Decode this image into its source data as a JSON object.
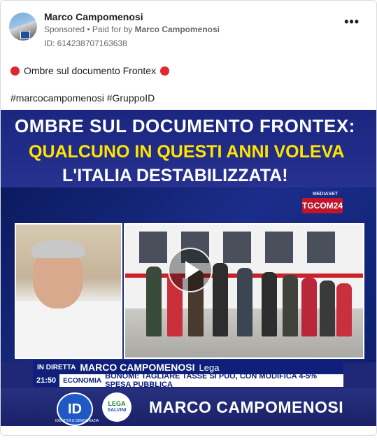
{
  "advertiser": {
    "name": "Marco Campomenosi",
    "sponsored_label": "Sponsored",
    "paid_for_prefix": "Paid for by",
    "paid_for_name": "Marco Campomenosi",
    "ad_id": "ID: 614238707163638"
  },
  "menu": {
    "more_icon": "more-options-icon",
    "more_glyph": "•••"
  },
  "post": {
    "title": "Ombre sul documento Frontex",
    "hashtags": "#marcocampomenosi #GruppoID"
  },
  "video": {
    "headline_line1": "OMBRE SUL DOCUMENTO FRONTEX:",
    "headline_line2": "QUALCUNO IN QUESTI ANNI VOLEVA",
    "headline_line3": "L'ITALIA DESTABILIZZATA!",
    "network_small": "MEDIASET",
    "network_logo": "TGCOM24",
    "ticker_live": "IN DIRETTA",
    "ticker_name": "MARCO CAMPOMENOSI",
    "ticker_party": "Lega",
    "ticker_time": "21:50",
    "ticker_section": "ECONOMIA",
    "ticker_text": "BONOMI: TAGLIARE TASSE SI PUÒ, CON MODIFICA 4-5% SPESA PUBBLICA",
    "id_logo": "ID",
    "id_caption": "IDENTITÀ E DEMOCRAZIA",
    "lega_logo_top": "LEGA",
    "lega_logo_bottom": "SALVINI",
    "bottom_name": "MARCO CAMPOMENOSI"
  },
  "colors": {
    "red_dot": "#e0262f",
    "video_blue": "#1f2877",
    "headline_yellow": "#ffe400"
  }
}
